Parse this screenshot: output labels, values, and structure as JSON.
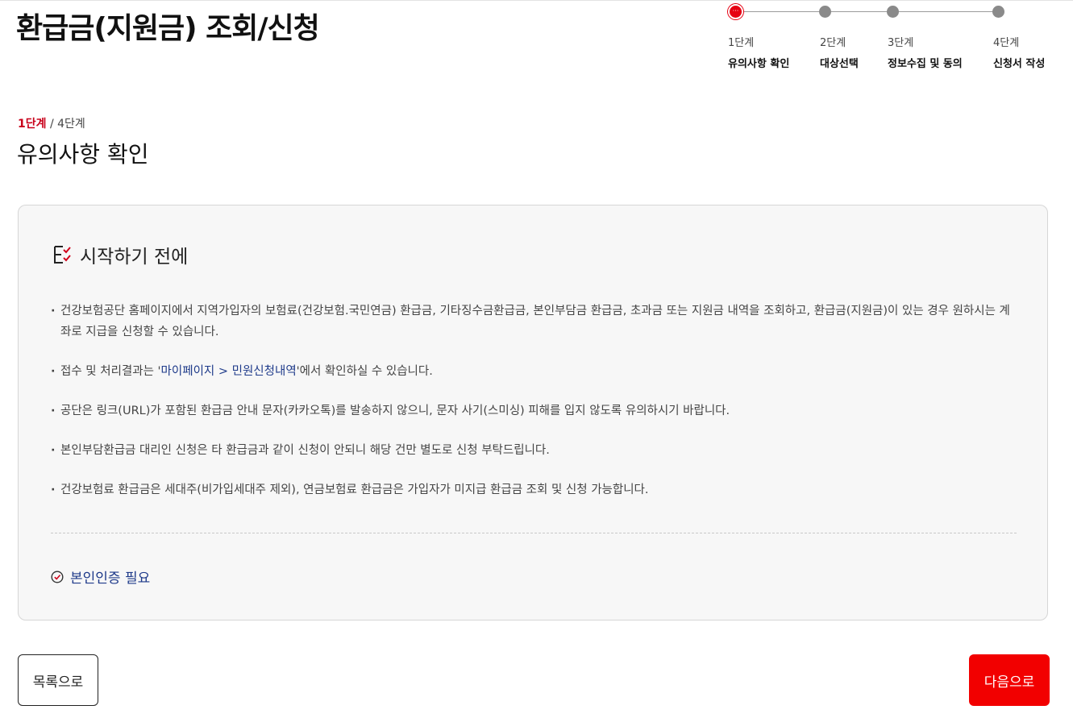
{
  "page": {
    "title": "환급금(지원금) 조회/신청"
  },
  "stepper": {
    "steps": [
      {
        "num": "1단계",
        "name": "유의사항 확인",
        "active": true
      },
      {
        "num": "2단계",
        "name": "대상선택",
        "active": false
      },
      {
        "num": "3단계",
        "name": "정보수집 및 동의",
        "active": false
      },
      {
        "num": "4단계",
        "name": "신청서 작성",
        "active": false
      }
    ]
  },
  "progress": {
    "current": "1단계",
    "separator": " / ",
    "total": "4단계"
  },
  "section": {
    "title": "유의사항 확인"
  },
  "notice": {
    "heading": "시작하기 전에",
    "heading_icon": "checklist-icon",
    "items": [
      {
        "text": "건강보험공단 홈페이지에서 지역가입자의 보험료(건강보험.국민연금) 환급금, 기타징수금환급금, 본인부담금 환급금, 초과금 또는 지원금 내역을 조회하고, 환급금(지원금)이 있는 경우 원하시는 계좌로 지급을 신청할 수 있습니다."
      },
      {
        "before": "접수 및 처리결과는 '",
        "link": "마이페이지 > 민원신청내역",
        "after": "'에서 확인하실 수 있습니다."
      },
      {
        "text": "공단은 링크(URL)가 포함된 환급금 안내 문자(카카오톡)를 발송하지 않으니, 문자 사기(스미싱) 피해를 입지 않도록 유의하시기 바랍니다."
      },
      {
        "text": "본인부담환급금 대리인 신청은 타 환급금과 같이 신청이 안되니 해당 건만 별도로 신청 부탁드립니다."
      },
      {
        "text": "건강보험료 환급금은 세대주(비가입세대주 제외), 연금보험료 환급금은 가입자가 미지급 환급금 조회 및 신청 가능합니다."
      }
    ],
    "auth_label": "본인인증 필요",
    "auth_icon": "check-circle-icon"
  },
  "buttons": {
    "list_label": "목록으로",
    "next_label": "다음으로"
  },
  "colors": {
    "accent": "#e60012",
    "link": "#1e3a8a",
    "next_button": "#f20000"
  }
}
